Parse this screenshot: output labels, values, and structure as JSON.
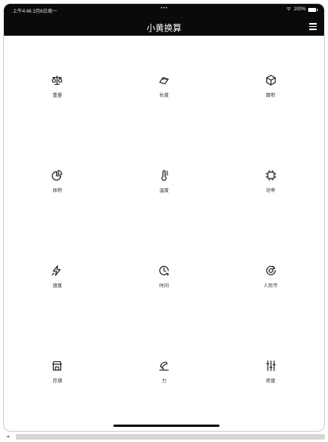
{
  "status_bar": {
    "time": "上午4:46  2月6日周一",
    "dots": "•••",
    "battery_text": "100%"
  },
  "header": {
    "title": "小黄换算"
  },
  "categories": [
    {
      "label": "重量",
      "icon": "scale-icon"
    },
    {
      "label": "长度",
      "icon": "ruler-icon"
    },
    {
      "label": "面积",
      "icon": "cube-icon"
    },
    {
      "label": "体积",
      "icon": "pie-chart-icon"
    },
    {
      "label": "温度",
      "icon": "thermometer-icon"
    },
    {
      "label": "功率",
      "icon": "chip-icon"
    },
    {
      "label": "速度",
      "icon": "lightning-icon"
    },
    {
      "label": "时间",
      "icon": "clock-icon"
    },
    {
      "label": "人民币",
      "icon": "currency-icon"
    },
    {
      "label": "存储",
      "icon": "storage-icon"
    },
    {
      "label": "力",
      "icon": "force-icon"
    },
    {
      "label": "密度",
      "icon": "sliders-icon"
    }
  ],
  "colors": {
    "header_bg": "#0a0a0a",
    "icon": "#222222",
    "label": "#333333"
  }
}
